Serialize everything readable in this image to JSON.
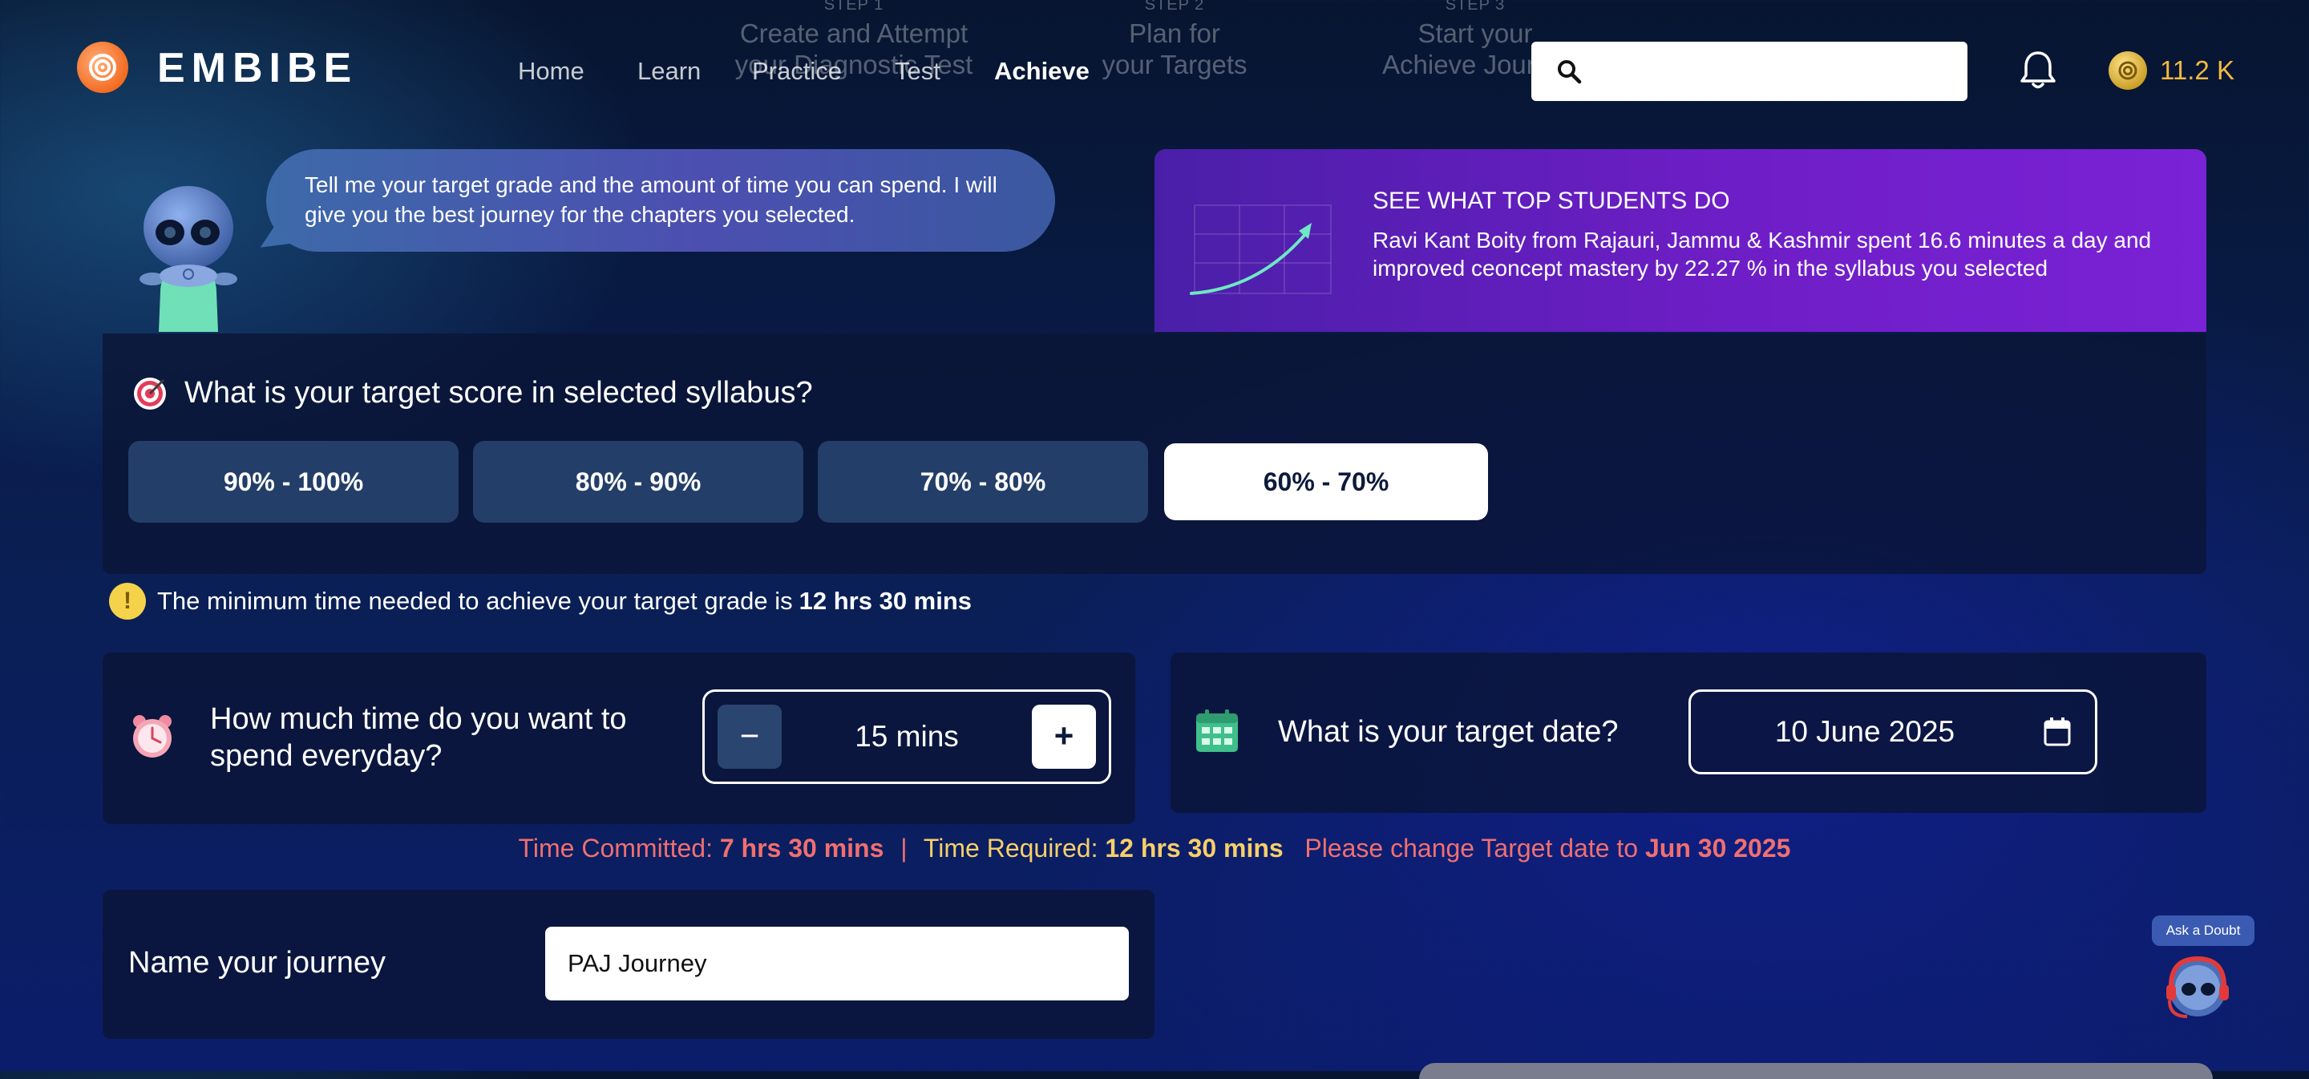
{
  "brand": {
    "name": "EMBIBE",
    "coins": "11.2 K"
  },
  "steps": [
    {
      "tag": "STEP 1",
      "line1": "Create and Attempt",
      "line2": "your Diagnostic Test"
    },
    {
      "tag": "STEP 2",
      "line1": "Plan for",
      "line2": "your Targets"
    },
    {
      "tag": "STEP 3",
      "line1": "Start your",
      "line2": "Achieve Journey"
    }
  ],
  "nav": {
    "items": [
      "Home",
      "Learn",
      "Practice",
      "Test",
      "Achieve"
    ],
    "active": "Achieve"
  },
  "search": {
    "placeholder": ""
  },
  "speech": {
    "text": "Tell me your target grade and the amount of time you can spend. I will give you the best journey for the chapters you selected."
  },
  "promo": {
    "title": "SEE WHAT TOP STUDENTS DO",
    "body": "Ravi Kant Boity from Rajauri, Jammu & Kashmir spent 16.6 minutes a day and improved ceoncept mastery by 22.27 % in the syllabus you selected"
  },
  "score": {
    "question": "What is your target score in selected syllabus?",
    "options": [
      "90% - 100%",
      "80% - 90%",
      "70% - 80%",
      "60% - 70%"
    ],
    "selected": "60% - 70%"
  },
  "warning": {
    "text": "The minimum time needed to achieve your target grade is",
    "value": "12 hrs 30 mins"
  },
  "time": {
    "question": "How much time do you want to spend everyday?",
    "value": "15 mins",
    "minus": "−",
    "plus": "+"
  },
  "date": {
    "question": "What is your target date?",
    "value": "10 June 2025"
  },
  "commit": {
    "committed_label": "Time Committed:",
    "committed_value": "7 hrs 30 mins",
    "separator": "|",
    "required_label": "Time Required:",
    "required_value": "12 hrs 30 mins",
    "change_label": "Please change Target date to",
    "change_value": "Jun 30 2025"
  },
  "journey": {
    "label": "Name your journey",
    "value": "PAJ Journey"
  },
  "ask": {
    "label": "Ask a Doubt"
  },
  "colors": {
    "accent_selected_bg": "#ffffff",
    "option_bg": "#233e68",
    "promo_purple": "#6e1ec6",
    "warning_red": "#f06f6f",
    "warning_yellow": "#f7cf6a",
    "coin": "#f5b940"
  }
}
